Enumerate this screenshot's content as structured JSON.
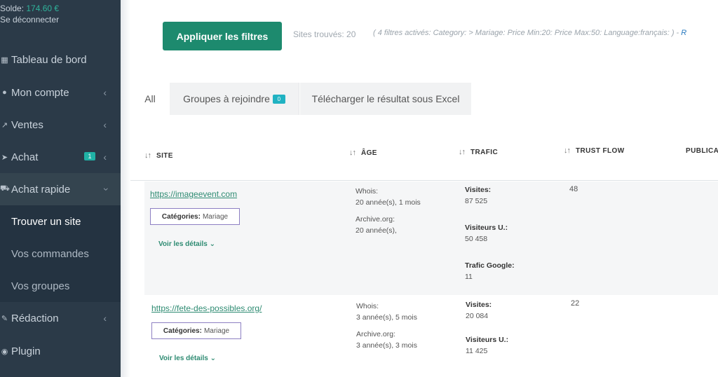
{
  "sidebar": {
    "balance_label": "Solde:",
    "balance_value": "174.60 €",
    "logout": "Se déconnecter",
    "items": [
      {
        "label": "Tableau de bord",
        "icon": "dashboard-icon"
      },
      {
        "label": "Mon compte",
        "icon": "user-icon"
      },
      {
        "label": "Ventes",
        "icon": "external-link-icon"
      },
      {
        "label": "Achat",
        "icon": "plane-icon",
        "badge": "1"
      },
      {
        "label": "Achat rapide",
        "icon": "cart-icon"
      },
      {
        "label": "Rédaction",
        "icon": "pencil-icon"
      },
      {
        "label": "Plugin",
        "icon": "plugin-icon"
      }
    ],
    "sub_items": [
      {
        "label": "Trouver un site"
      },
      {
        "label": "Vos commandes"
      },
      {
        "label": "Vos groupes"
      }
    ]
  },
  "toolbar": {
    "apply_label": "Appliquer les filtres",
    "found_text": "Sites trouvés: 20",
    "filters_text": "( 4 filtres activés: Category: > Mariage: Price Min:20: Price Max:50: Language:français: ) - ",
    "filters_link": "R"
  },
  "tabs": {
    "all": "All",
    "groups": "Groupes à rejoindre",
    "groups_count": "0",
    "excel": "Télécharger le résultat sous Excel"
  },
  "table": {
    "headers": {
      "site": "SITE",
      "age": "ÂGE",
      "trafic": "TRAFIC",
      "trust_flow": "TRUST FLOW",
      "publication": "PUBLICAT"
    },
    "rows": [
      {
        "url": "https://imageevent.com",
        "cat_label": "Catégories:",
        "cat_value": "Mariage",
        "details": "Voir les détails ⌄",
        "whois_label": "Whois:",
        "whois_value": "20 année(s), 1 mois",
        "archive_label": "Archive.org:",
        "archive_value": "20 année(s),",
        "visites_label": "Visites:",
        "visites_value": "87 525",
        "visiteurs_label": "Visiteurs U.:",
        "visiteurs_value": "50 458",
        "google_label": "Trafic Google:",
        "google_value": "11",
        "trust_flow": "48"
      },
      {
        "url": "https://fete-des-possibles.org/",
        "cat_label": "Catégories:",
        "cat_value": "Mariage",
        "details": "Voir les détails ⌄",
        "whois_label": "Whois:",
        "whois_value": "3 année(s), 5 mois",
        "archive_label": "Archive.org:",
        "archive_value": "3 année(s), 3 mois",
        "visites_label": "Visites:",
        "visites_value": "20 084",
        "visiteurs_label": "Visiteurs U.:",
        "visiteurs_value": "11 425",
        "trust_flow": "22"
      }
    ]
  }
}
